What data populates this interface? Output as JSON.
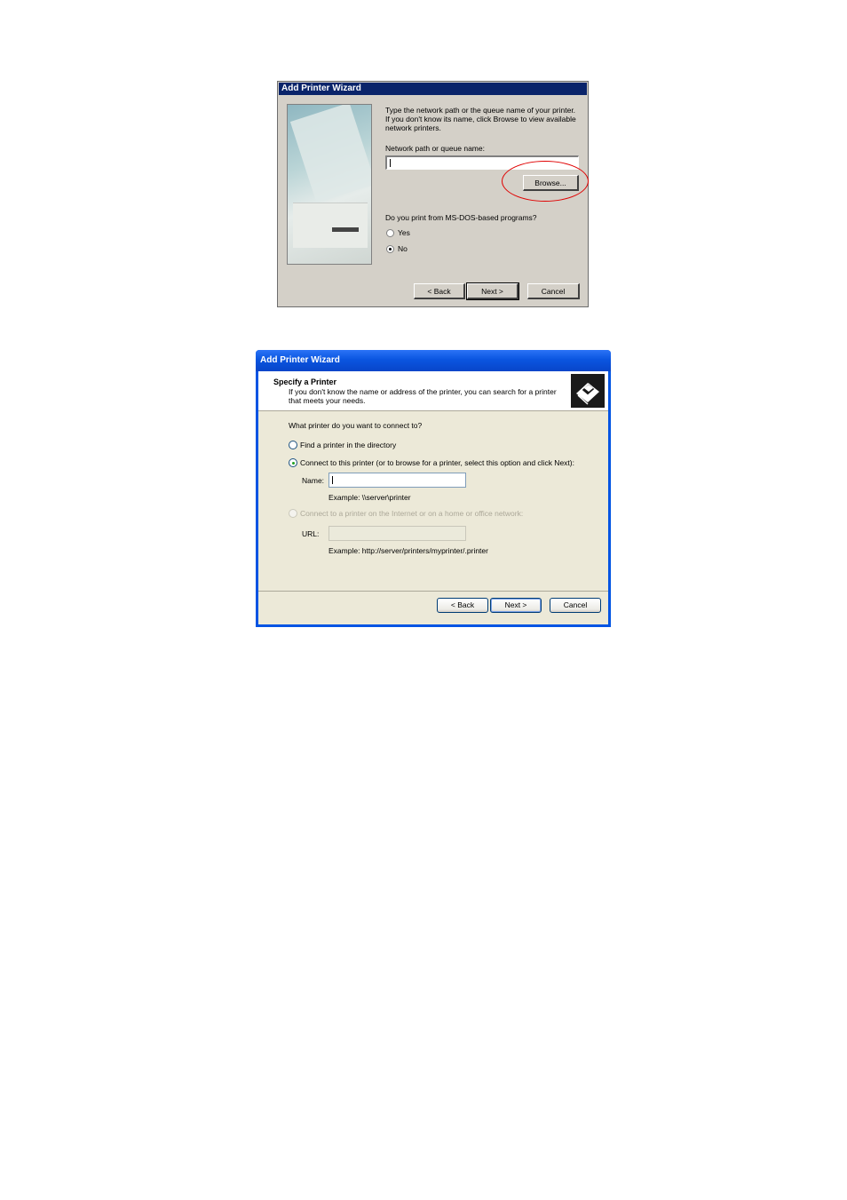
{
  "dialog1": {
    "title": "Add Printer Wizard",
    "intro_line1": "Type the network path or the queue name of your printer.",
    "intro_line2": "If you don't know its name, click Browse to view available",
    "intro_line3": "network printers.",
    "path_label": "Network path or queue name:",
    "path_value": "",
    "browse_label": "Browse...",
    "dos_question": "Do you print from MS-DOS-based programs?",
    "radio_yes": "Yes",
    "radio_no": "No",
    "selected": "No",
    "back_label": "< Back",
    "next_label": "Next >",
    "cancel_label": "Cancel",
    "highlight_color": "#e00000"
  },
  "dialog2": {
    "title": "Add Printer Wizard",
    "header_title": "Specify a Printer",
    "header_sub_line1": "If you don't know the name or address of the printer, you can search for a printer",
    "header_sub_line2": "that meets your needs.",
    "question": "What printer do you want to connect to?",
    "option_find": "Find a printer in the directory",
    "option_connect": "Connect to this printer (or to browse for a printer, select this option and click Next):",
    "name_label": "Name:",
    "name_value": "",
    "name_example": "Example: \\\\server\\printer",
    "option_internet": "Connect to a printer on the Internet or on a home or office network:",
    "url_label": "URL:",
    "url_value": "",
    "url_example": "Example: http://server/printers/myprinter/.printer",
    "selected": "Connect to this printer",
    "back_label": "< Back",
    "next_label": "Next >",
    "cancel_label": "Cancel",
    "icon": "printer-icon"
  }
}
